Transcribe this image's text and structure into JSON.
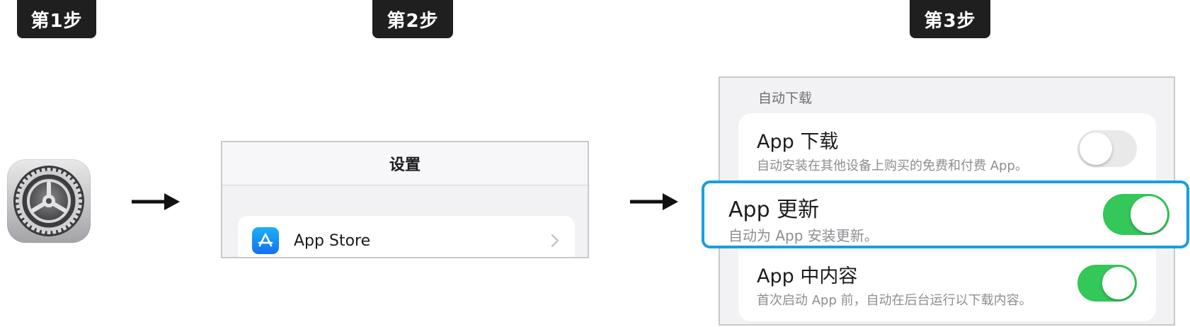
{
  "steps": {
    "step1": "第1步",
    "step2": "第2步",
    "step3": "第3步"
  },
  "step1_icon": "settings-gear-icon",
  "step2": {
    "header": "设置",
    "row_label": "App Store",
    "row_icon": "app-store-icon"
  },
  "step3": {
    "section_header": "自动下载",
    "rows": [
      {
        "title": "App 下载",
        "subtitle": "自动安装在其他设备上购买的免费和付费 App。",
        "toggle": "off"
      },
      {
        "title": "App 更新",
        "subtitle": "自动为 App 安装更新。",
        "toggle": "on",
        "highlighted": true
      },
      {
        "title": "App 中内容",
        "subtitle": "首次启动 App 前，自动在后台运行以下载内容。",
        "toggle": "on"
      }
    ]
  },
  "colors": {
    "label_bg": "#1f1f1f",
    "toggle_on": "#34c759",
    "toggle_off": "#e9e9ea",
    "highlight": "#1a9ee0",
    "app_store_blue": "#1570ef"
  }
}
